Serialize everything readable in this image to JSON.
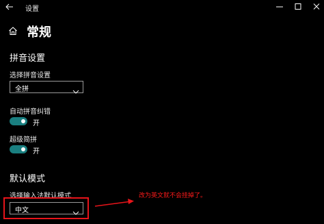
{
  "window": {
    "title": "设置",
    "controls": {
      "minimize": "minimize-icon",
      "maximize": "maximize-icon",
      "close": "close-icon"
    }
  },
  "header": {
    "title": "常规"
  },
  "pinyin_section": {
    "title": "拼音设置",
    "select_label": "选择拼音设置",
    "select_value": "全拼"
  },
  "auto_correct": {
    "label": "自动拼音纠错",
    "state": "开",
    "on": true
  },
  "super_jianpin": {
    "label": "超级简拼",
    "state": "开",
    "on": true
  },
  "default_mode_section": {
    "title": "默认模式",
    "select_label": "选择输入法默认模式",
    "select_value": "中文"
  },
  "annotation": {
    "text": "改为英文就不会挂掉了。"
  },
  "colors": {
    "background": "#000000",
    "accent": "#1a7f80",
    "annotation": "#ff1a1a"
  }
}
